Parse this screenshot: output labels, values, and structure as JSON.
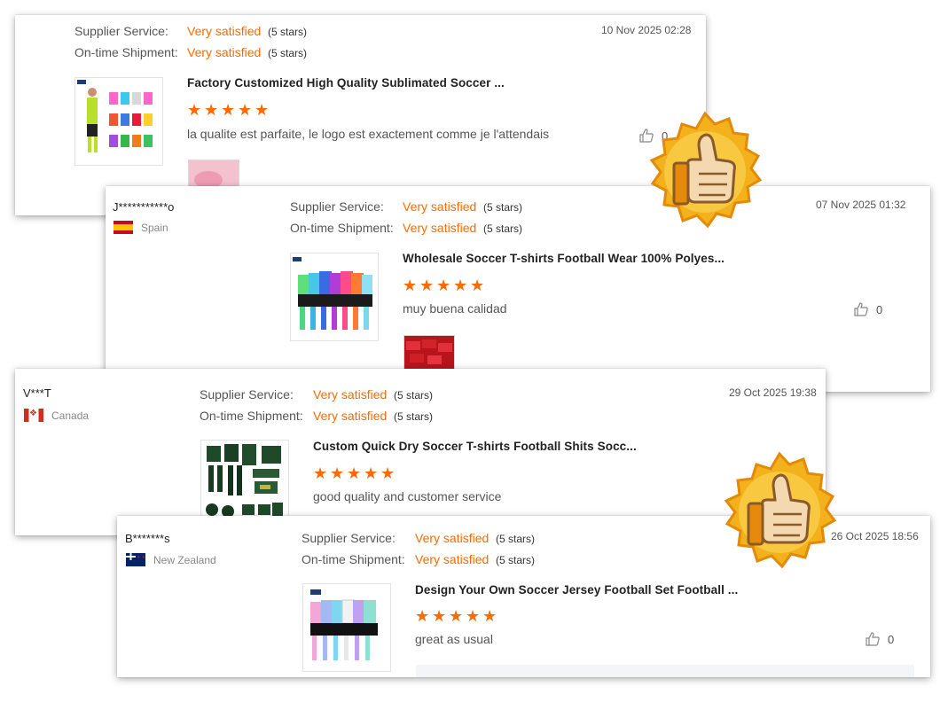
{
  "reviews": [
    {
      "user": "",
      "country": "",
      "supplier_service_label": "Supplier Service:",
      "supplier_service_value": "Very satisfied",
      "supplier_service_stars": "(5 stars)",
      "shipment_label": "On-time Shipment:",
      "shipment_value": "Very satisfied",
      "shipment_stars": "(5 stars)",
      "date": "10 Nov 2025 02:28",
      "product_title": "Factory Customized High Quality Sublimated Soccer ...",
      "rating": 5,
      "comment": "la qualite est parfaite, le logo est exactement comme je l'attendais",
      "likes": "0"
    },
    {
      "user": "J***********o",
      "country": "Spain",
      "supplier_service_label": "Supplier Service:",
      "supplier_service_value": "Very satisfied",
      "supplier_service_stars": "(5 stars)",
      "shipment_label": "On-time Shipment:",
      "shipment_value": "Very satisfied",
      "shipment_stars": "(5 stars)",
      "date": "07 Nov 2025 01:32",
      "product_title": "Wholesale Soccer T-shirts Football Wear 100% Polyes...",
      "rating": 5,
      "comment": "muy buena calidad",
      "likes": "0"
    },
    {
      "user": "V***T",
      "country": "Canada",
      "supplier_service_label": "Supplier Service:",
      "supplier_service_value": "Very satisfied",
      "supplier_service_stars": "(5 stars)",
      "shipment_label": "On-time Shipment:",
      "shipment_value": "Very satisfied",
      "shipment_stars": "(5 stars)",
      "date": "29 Oct 2025 19:38",
      "product_title": "Custom Quick Dry Soccer T-shirts Football Shits Socc...",
      "rating": 5,
      "comment": "good quality and customer service",
      "likes": ""
    },
    {
      "user": "B*******s",
      "country": "New Zealand",
      "supplier_service_label": "Supplier Service:",
      "supplier_service_value": "Very satisfied",
      "supplier_service_stars": "(5 stars)",
      "shipment_label": "On-time Shipment:",
      "shipment_value": "Very satisfied",
      "shipment_stars": "(5 stars)",
      "date": "26 Oct 2025 18:56",
      "product_title": "Design Your Own Soccer Jersey Football Set Football ...",
      "rating": 5,
      "comment": "great as usual",
      "likes": "0"
    }
  ],
  "colors": {
    "accent": "#ff6a00",
    "badge_gold": "#f2b51c",
    "badge_orange": "#e58a0b"
  },
  "icons": {
    "rating": "star-icon",
    "like": "thumbs-up-icon",
    "badge": "thumbs-up-badge-icon"
  }
}
